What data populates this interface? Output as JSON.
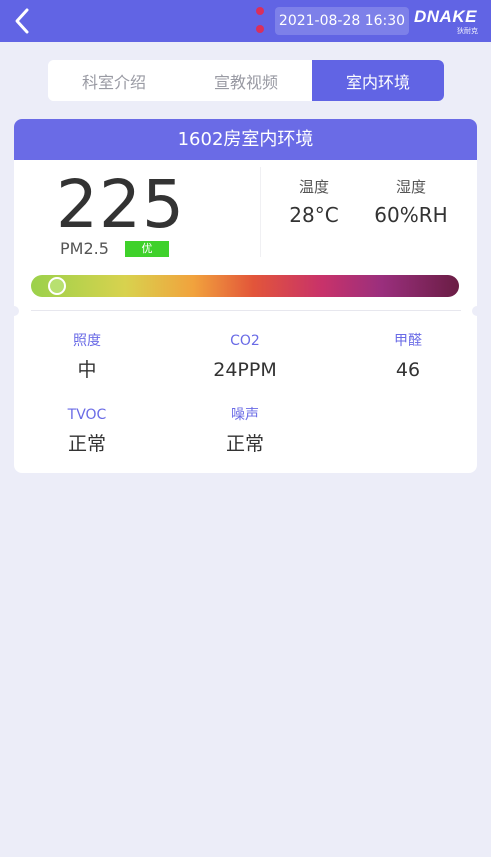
{
  "topbar": {
    "datetime": "2021-08-28 16:30",
    "brand": "DNAKE",
    "brand_sub": "狄耐克",
    "back_icon": "chevron-left-icon"
  },
  "tabs": [
    {
      "label": "科室介绍",
      "active": false
    },
    {
      "label": "宣教视频",
      "active": false
    },
    {
      "label": "室内环境",
      "active": true
    }
  ],
  "card": {
    "title": "1602房室内环境",
    "pm25": {
      "value": "225",
      "label": "PM2.5",
      "grade": "优",
      "grade_color": "#3fd12b",
      "scale_position_percent": 2
    },
    "temperature": {
      "label": "温度",
      "value": "28°C"
    },
    "humidity": {
      "label": "湿度",
      "value": "60%RH"
    },
    "metrics": [
      {
        "label": "照度",
        "value": "中"
      },
      {
        "label": "CO2",
        "value": "24PPM"
      },
      {
        "label": "甲醛",
        "value": "46"
      },
      {
        "label": "TVOC",
        "value": "正常"
      },
      {
        "label": "噪声",
        "value": "正常"
      }
    ]
  },
  "colors": {
    "primary": "#6164e4",
    "background": "#ecedf8",
    "label_accent": "#6a6be6"
  }
}
